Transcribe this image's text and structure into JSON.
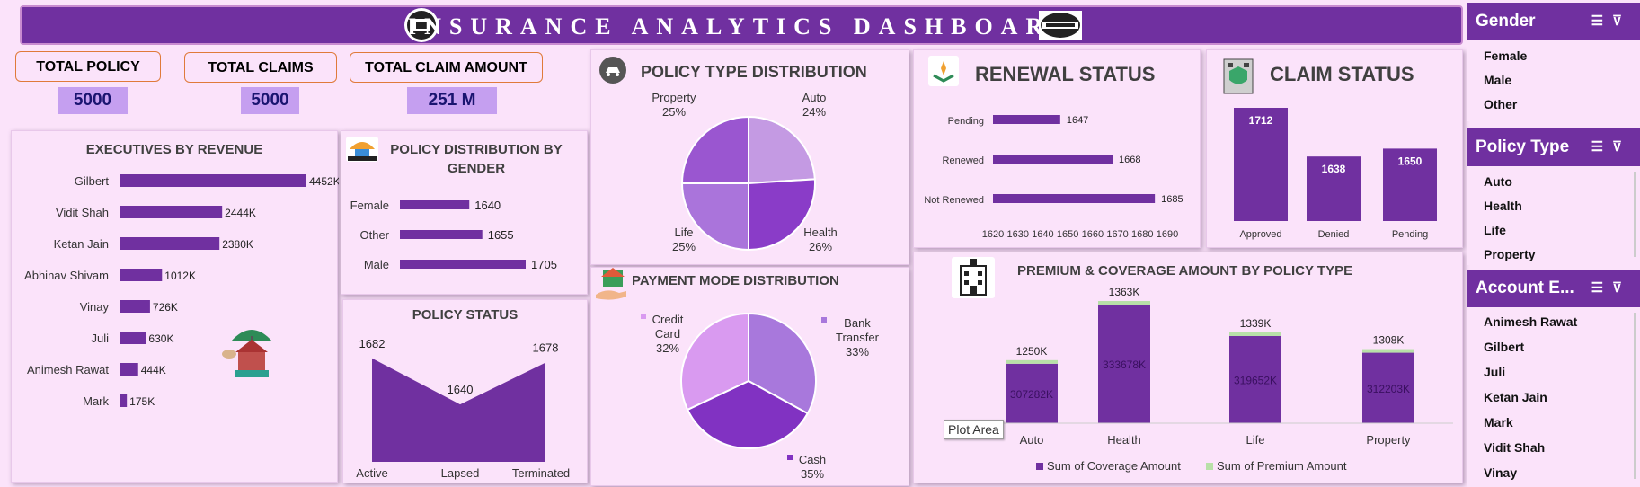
{
  "header": {
    "title": "INSURANCE ANALYTICS DASHBOARD"
  },
  "kpis": [
    {
      "label": "TOTAL POLICY",
      "value": "5000"
    },
    {
      "label": "TOTAL CLAIMS",
      "value": "5000"
    },
    {
      "label": "TOTAL CLAIM AMOUNT",
      "value": "251 M"
    }
  ],
  "panels": {
    "executives_title": "EXECUTIVES BY REVENUE",
    "gender_title": "POLICY DISTRIBUTION BY GENDER",
    "status_title": "POLICY STATUS",
    "policy_type_title": "POLICY TYPE DISTRIBUTION",
    "payment_title": "PAYMENT MODE DISTRIBUTION",
    "renewal_title": "RENEWAL STATUS",
    "claim_title": "CLAIM STATUS",
    "premium_title": "PREMIUM & COVERAGE AMOUNT BY POLICY TYPE"
  },
  "tooltip": "Plot Area",
  "slicers": {
    "gender": {
      "title": "Gender",
      "items": [
        "Female",
        "Male",
        "Other"
      ]
    },
    "policy_type": {
      "title": "Policy Type",
      "items": [
        "Auto",
        "Health",
        "Life",
        "Property"
      ]
    },
    "account": {
      "title": "Account E...",
      "items": [
        "Animesh Rawat",
        "Gilbert",
        "Juli",
        "Ketan Jain",
        "Mark",
        "Vidit Shah",
        "Vinay"
      ]
    }
  },
  "colors": {
    "accent": "#7030a0",
    "background": "#fbe3fa",
    "bar": "#7030a0",
    "premium": "#b8e0a8"
  },
  "chart_data": [
    {
      "id": "executives",
      "type": "bar",
      "orientation": "horizontal",
      "categories": [
        "Gilbert",
        "Vidit Shah",
        "Ketan Jain",
        "Abhinav Shivam",
        "Vinay",
        "Juli",
        "Animesh Rawat",
        "Mark"
      ],
      "values": [
        4452,
        2444,
        2380,
        1012,
        726,
        630,
        444,
        175
      ],
      "labels": [
        "4452K",
        "2444K",
        "2380K",
        "1012K",
        "726K",
        "630K",
        "444K",
        "175K"
      ]
    },
    {
      "id": "gender",
      "type": "bar",
      "orientation": "horizontal",
      "categories": [
        "Female",
        "Other",
        "Male"
      ],
      "values": [
        1640,
        1655,
        1705
      ]
    },
    {
      "id": "status",
      "type": "area",
      "categories": [
        "Active",
        "Lapsed",
        "Terminated"
      ],
      "values": [
        1682,
        1640,
        1678
      ]
    },
    {
      "id": "policy_type",
      "type": "pie",
      "slices": [
        {
          "label": "Auto",
          "pct": "24%",
          "value": 24,
          "color": "#c49ae3"
        },
        {
          "label": "Health",
          "pct": "26%",
          "value": 26,
          "color": "#8a3cc8"
        },
        {
          "label": "Life",
          "pct": "25%",
          "value": 25,
          "color": "#aa74db"
        },
        {
          "label": "Property",
          "pct": "25%",
          "value": 25,
          "color": "#9a56d0"
        }
      ]
    },
    {
      "id": "payment",
      "type": "pie",
      "slices": [
        {
          "label": "Bank Transfer",
          "pct": "33%",
          "value": 33,
          "color": "#a878dc"
        },
        {
          "label": "Cash",
          "pct": "35%",
          "value": 35,
          "color": "#8132c2"
        },
        {
          "label": "Credit Card",
          "pct": "32%",
          "value": 32,
          "color": "#d99af0"
        }
      ]
    },
    {
      "id": "renewal",
      "type": "bar",
      "orientation": "horizontal",
      "categories": [
        "Pending",
        "Renewed",
        "Not Renewed"
      ],
      "values": [
        1647,
        1668,
        1685
      ],
      "xlim": [
        1620,
        1690
      ],
      "ticks": [
        "1620",
        "1630",
        "1640",
        "1650",
        "1660",
        "1670",
        "1680",
        "1690"
      ]
    },
    {
      "id": "claim",
      "type": "bar",
      "categories": [
        "Approved",
        "Denied",
        "Pending"
      ],
      "values": [
        1712,
        1638,
        1650
      ]
    },
    {
      "id": "premium",
      "type": "bar",
      "stacked": true,
      "categories": [
        "Auto",
        "Health",
        "Life",
        "Property"
      ],
      "series": [
        {
          "name": "Sum of Coverage Amount",
          "values": [
            307282,
            333678,
            319652,
            312203
          ],
          "labels": [
            "307282K",
            "333678K",
            "319652K",
            "312203K"
          ],
          "color": "#7030a0"
        },
        {
          "name": "Sum of Premium Amount",
          "values": [
            1250,
            1363,
            1339,
            1308
          ],
          "labels": [
            "1250K",
            "1363K",
            "1339K",
            "1308K"
          ],
          "color": "#b8e0a8"
        }
      ]
    }
  ]
}
